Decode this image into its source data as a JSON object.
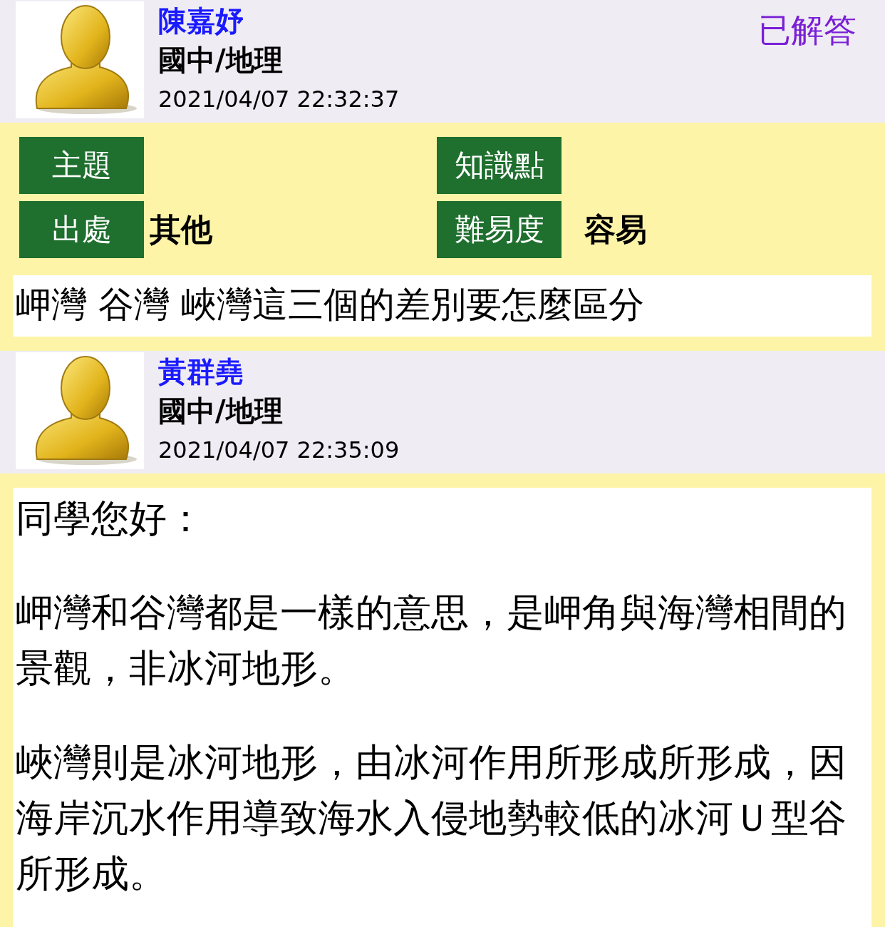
{
  "posts": [
    {
      "kind": "question",
      "author": "陳嘉妤",
      "subject": "國中/地理",
      "time": "2021/04/07 22:32:37",
      "status": "已解答",
      "fields": [
        {
          "label": "主題"
        },
        {
          "label": "知識點"
        },
        {
          "label": "出處",
          "value": "其他"
        },
        {
          "label": "難易度",
          "value": "容易"
        }
      ],
      "paragraphs": [
        "岬灣 谷灣 峽灣這三個的差別要怎麼區分"
      ]
    },
    {
      "kind": "answer",
      "author": "黃群堯",
      "subject": "國中/地理",
      "time": "2021/04/07 22:35:09",
      "paragraphs": [
        "同學您好：",
        "岬灣和谷灣都是一樣的意思，是岬角與海灣相間的景觀，非冰河地形。",
        "峽灣則是冰河地形，由冰河作用所形成所形成，因海岸沉水作用導致海水入侵地勢較低的冰河Ｕ型谷所形成。"
      ]
    }
  ]
}
